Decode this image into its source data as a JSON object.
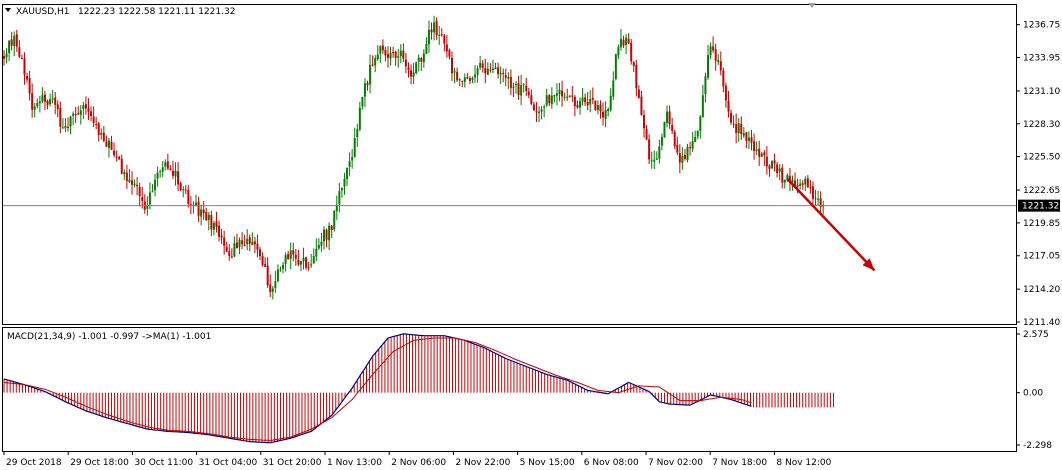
{
  "header": {
    "menu_icon": "triangle-down-icon",
    "symbol": "XAUUSD,H1",
    "ohlc": "1222.23 1222.58 1221.11 1221.32"
  },
  "indicator": {
    "label": "MACD(21,34,9) -1.001 -0.997  ->MA(1) -1.001"
  },
  "colors": {
    "background": "#ffffff",
    "bull": "#008000",
    "bear": "#cc0000",
    "macd_hist": "#cc0000",
    "macd_line": "#00007f",
    "signal_line": "#cc0000",
    "arrow": "#cc0000",
    "price_line": "#808080",
    "price_label_bg": "#000000"
  },
  "chart_data": [
    {
      "type": "candlestick",
      "title": "XAUUSD,H1",
      "ylim": [
        1211.4,
        1238.0
      ],
      "y_ticks": [
        "1236.75",
        "1233.95",
        "1231.10",
        "1228.30",
        "1225.50",
        "1222.65",
        "1219.85",
        "1217.05",
        "1214.20",
        "1211.40"
      ],
      "current_price": "1221.32",
      "x_ticks": [
        "29 Oct 2018",
        "29 Oct 18:00",
        "30 Oct 11:00",
        "31 Oct 04:00",
        "31 Oct 20:00",
        "1 Nov 13:00",
        "2 Nov 06:00",
        "2 Nov 22:00",
        "5 Nov 15:00",
        "6 Nov 08:00",
        "7 Nov 02:00",
        "7 Nov 18:00",
        "8 Nov 12:00"
      ],
      "anchors": [
        [
          0,
          1234.2
        ],
        [
          4,
          1235.6
        ],
        [
          8,
          1233.2
        ],
        [
          12,
          1229.4
        ],
        [
          16,
          1230.4
        ],
        [
          20,
          1230.0
        ],
        [
          24,
          1227.6
        ],
        [
          28,
          1229.3
        ],
        [
          32,
          1230.2
        ],
        [
          36,
          1228.3
        ],
        [
          40,
          1226.8
        ],
        [
          44,
          1225.9
        ],
        [
          48,
          1223.6
        ],
        [
          52,
          1223.0
        ],
        [
          56,
          1220.9
        ],
        [
          60,
          1224.4
        ],
        [
          64,
          1225.0
        ],
        [
          68,
          1223.7
        ],
        [
          72,
          1222.1
        ],
        [
          76,
          1221.0
        ],
        [
          80,
          1220.3
        ],
        [
          84,
          1219.0
        ],
        [
          88,
          1217.1
        ],
        [
          92,
          1218.2
        ],
        [
          96,
          1218.6
        ],
        [
          100,
          1217.8
        ],
        [
          104,
          1214.3
        ],
        [
          108,
          1215.6
        ],
        [
          112,
          1217.2
        ],
        [
          116,
          1216.7
        ],
        [
          120,
          1216.3
        ],
        [
          124,
          1218.5
        ],
        [
          128,
          1219.2
        ],
        [
          132,
          1222.7
        ],
        [
          136,
          1225.1
        ],
        [
          140,
          1230.1
        ],
        [
          144,
          1233.2
        ],
        [
          148,
          1234.7
        ],
        [
          152,
          1234.3
        ],
        [
          156,
          1234.1
        ],
        [
          160,
          1232.6
        ],
        [
          164,
          1234.2
        ],
        [
          168,
          1236.7
        ],
        [
          172,
          1235.4
        ],
        [
          176,
          1232.5
        ],
        [
          180,
          1231.6
        ],
        [
          184,
          1232.7
        ],
        [
          188,
          1233.1
        ],
        [
          192,
          1232.6
        ],
        [
          196,
          1232.2
        ],
        [
          200,
          1231.1
        ],
        [
          204,
          1231.6
        ],
        [
          208,
          1229.5
        ],
        [
          212,
          1230.4
        ],
        [
          216,
          1230.9
        ],
        [
          220,
          1230.3
        ],
        [
          224,
          1230.1
        ],
        [
          228,
          1230.5
        ],
        [
          232,
          1229.7
        ],
        [
          236,
          1229.1
        ],
        [
          240,
          1234.6
        ],
        [
          244,
          1235.9
        ],
        [
          248,
          1231.1
        ],
        [
          252,
          1225.8
        ],
        [
          256,
          1225.6
        ],
        [
          260,
          1229.3
        ],
        [
          264,
          1225.1
        ],
        [
          268,
          1226.2
        ],
        [
          272,
          1228.5
        ],
        [
          276,
          1235.1
        ],
        [
          280,
          1233.6
        ],
        [
          284,
          1228.4
        ],
        [
          288,
          1227.8
        ],
        [
          292,
          1227.0
        ],
        [
          296,
          1225.6
        ],
        [
          300,
          1224.9
        ],
        [
          304,
          1223.9
        ],
        [
          308,
          1223.3
        ],
        [
          312,
          1223.5
        ],
        [
          316,
          1222.6
        ],
        [
          320,
          1221.3
        ]
      ],
      "forecast_arrow": {
        "from_bar": 306,
        "from_price": 1223.6,
        "to_bar": 340,
        "to_price": 1215.8
      }
    },
    {
      "type": "histogram+line",
      "title": "MACD(21,34,9)",
      "ylim": [
        -2.298,
        2.575
      ],
      "y_ticks": [
        "2.575",
        "0.00",
        "-2.298"
      ],
      "macd_anchors": [
        [
          0,
          0.6
        ],
        [
          8,
          0.35
        ],
        [
          16,
          0.05
        ],
        [
          24,
          -0.4
        ],
        [
          32,
          -0.8
        ],
        [
          40,
          -1.1
        ],
        [
          48,
          -1.35
        ],
        [
          56,
          -1.6
        ],
        [
          64,
          -1.7
        ],
        [
          72,
          -1.75
        ],
        [
          80,
          -1.85
        ],
        [
          88,
          -2.0
        ],
        [
          96,
          -2.15
        ],
        [
          104,
          -2.2
        ],
        [
          112,
          -2.0
        ],
        [
          120,
          -1.7
        ],
        [
          128,
          -1.0
        ],
        [
          136,
          0.2
        ],
        [
          144,
          1.6
        ],
        [
          150,
          2.4
        ],
        [
          156,
          2.58
        ],
        [
          164,
          2.5
        ],
        [
          172,
          2.5
        ],
        [
          180,
          2.3
        ],
        [
          188,
          1.95
        ],
        [
          196,
          1.5
        ],
        [
          204,
          1.15
        ],
        [
          212,
          0.8
        ],
        [
          220,
          0.55
        ],
        [
          228,
          0.1
        ],
        [
          236,
          -0.05
        ],
        [
          244,
          0.45
        ],
        [
          252,
          0.05
        ],
        [
          256,
          -0.4
        ],
        [
          260,
          -0.5
        ],
        [
          268,
          -0.55
        ],
        [
          276,
          -0.1
        ],
        [
          284,
          -0.3
        ],
        [
          292,
          -0.6
        ]
      ],
      "signal_anchors": [
        [
          0,
          0.45
        ],
        [
          8,
          0.35
        ],
        [
          16,
          0.15
        ],
        [
          24,
          -0.2
        ],
        [
          32,
          -0.6
        ],
        [
          40,
          -0.95
        ],
        [
          48,
          -1.25
        ],
        [
          56,
          -1.5
        ],
        [
          64,
          -1.65
        ],
        [
          72,
          -1.7
        ],
        [
          80,
          -1.8
        ],
        [
          88,
          -1.95
        ],
        [
          96,
          -2.05
        ],
        [
          104,
          -2.1
        ],
        [
          112,
          -1.95
        ],
        [
          120,
          -1.6
        ],
        [
          128,
          -1.1
        ],
        [
          136,
          -0.3
        ],
        [
          144,
          0.8
        ],
        [
          152,
          1.8
        ],
        [
          160,
          2.3
        ],
        [
          168,
          2.4
        ],
        [
          176,
          2.4
        ],
        [
          184,
          2.2
        ],
        [
          192,
          1.85
        ],
        [
          200,
          1.45
        ],
        [
          208,
          1.1
        ],
        [
          216,
          0.75
        ],
        [
          224,
          0.45
        ],
        [
          232,
          0.1
        ],
        [
          240,
          0.0
        ],
        [
          248,
          0.3
        ],
        [
          256,
          0.25
        ],
        [
          264,
          -0.35
        ],
        [
          272,
          -0.35
        ],
        [
          280,
          -0.2
        ],
        [
          288,
          -0.3
        ],
        [
          292,
          -0.45
        ]
      ]
    }
  ]
}
